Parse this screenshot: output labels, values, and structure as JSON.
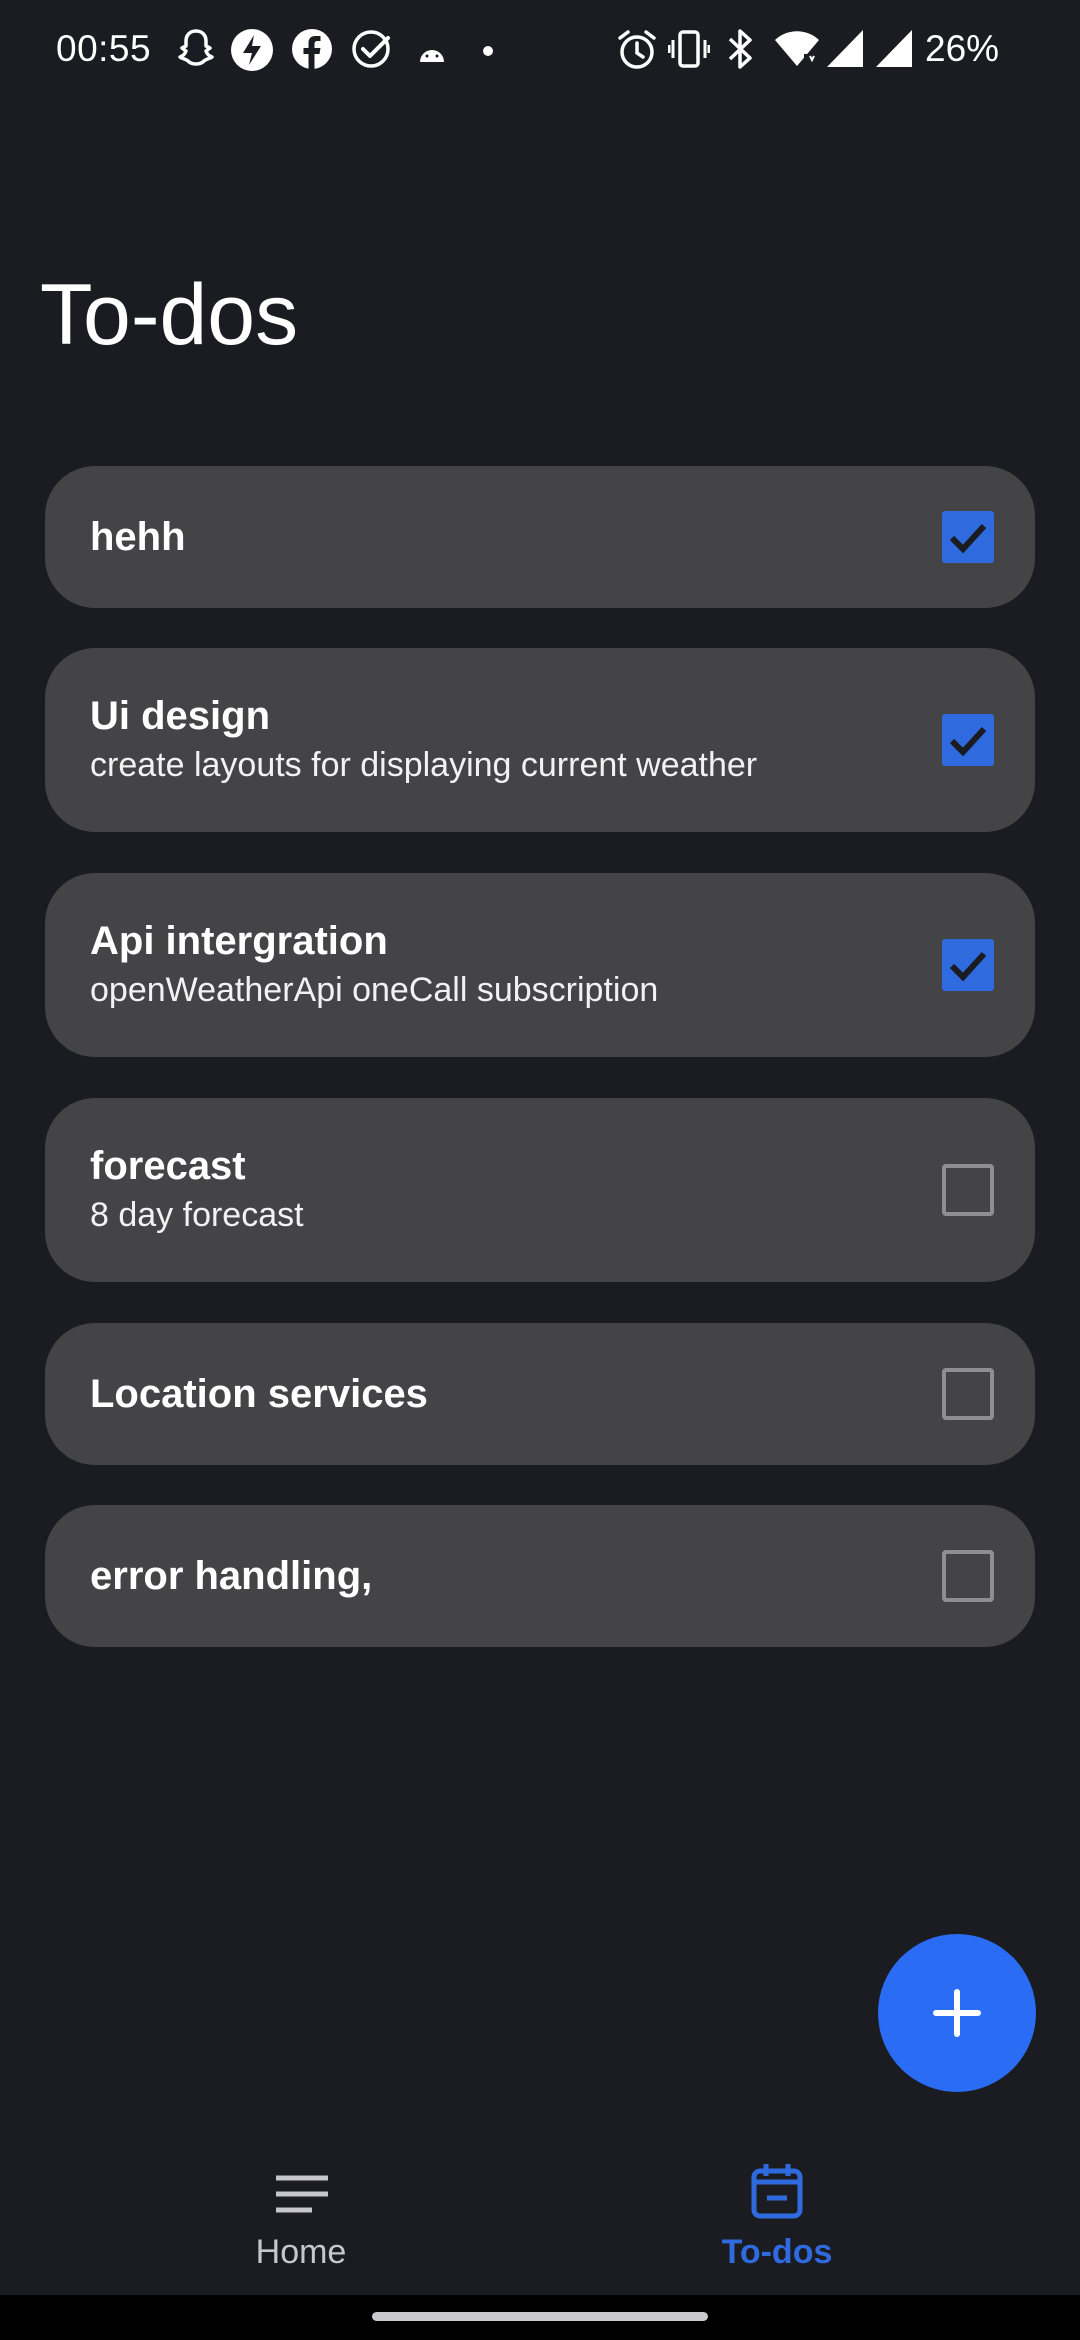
{
  "status_bar": {
    "time": "00:55",
    "battery": "26%",
    "left_icons": [
      "snapchat-icon",
      "messenger-icon",
      "facebook-icon",
      "tasks-check-icon",
      "android-icon",
      "dot-icon"
    ],
    "right_icons": [
      "alarm-icon",
      "vibrate-icon",
      "bluetooth-icon",
      "wifi-icon",
      "signal-icon",
      "signal-icon"
    ]
  },
  "header": {
    "title": "To-dos"
  },
  "todos": [
    {
      "title": "hehh",
      "subtitle": "",
      "checked": true
    },
    {
      "title": "Ui design",
      "subtitle": "create layouts for displaying current weather",
      "checked": true
    },
    {
      "title": "Api intergration",
      "subtitle": "openWeatherApi oneCall subscription",
      "checked": true
    },
    {
      "title": "forecast",
      "subtitle": "8 day forecast",
      "checked": false
    },
    {
      "title": "Location services",
      "subtitle": "",
      "checked": false
    },
    {
      "title": "error handling,",
      "subtitle": "",
      "checked": false
    }
  ],
  "fab": {
    "icon": "plus-icon"
  },
  "bottom_nav": {
    "home_label": "Home",
    "todos_label": "To-dos",
    "active": "To-dos"
  },
  "colors": {
    "background": "#1b1c21",
    "card": "#444446",
    "accent": "#2f6bdf",
    "fab": "#2a6cf4"
  }
}
